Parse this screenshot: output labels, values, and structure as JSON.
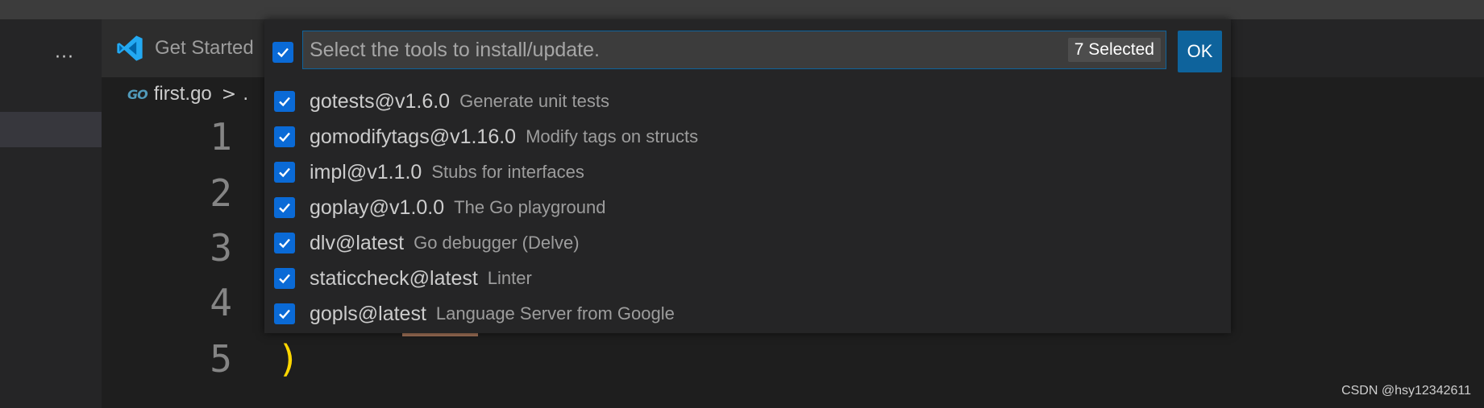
{
  "tab": {
    "label": "Get Started",
    "icon": "vscode-icon"
  },
  "breadcrumb": {
    "file": "first.go",
    "file_icon": "GO",
    "separator": ">",
    "more": "."
  },
  "editor": {
    "line_numbers": [
      "1",
      "2",
      "3",
      "4",
      "5"
    ],
    "closing_paren": ")"
  },
  "quickpick": {
    "placeholder": "Select the tools to install/update.",
    "selected_count": "7 Selected",
    "ok_label": "OK",
    "items": [
      {
        "name": "gotests@v1.6.0",
        "description": "Generate unit tests",
        "checked": true
      },
      {
        "name": "gomodifytags@v1.16.0",
        "description": "Modify tags on structs",
        "checked": true
      },
      {
        "name": "impl@v1.1.0",
        "description": "Stubs for interfaces",
        "checked": true
      },
      {
        "name": "goplay@v1.0.0",
        "description": "The Go playground",
        "checked": true
      },
      {
        "name": "dlv@latest",
        "description": "Go debugger (Delve)",
        "checked": true
      },
      {
        "name": "staticcheck@latest",
        "description": "Linter",
        "checked": true
      },
      {
        "name": "gopls@latest",
        "description": "Language Server from Google",
        "checked": true
      }
    ]
  },
  "sidebar": {
    "more_label": "···"
  },
  "watermark": "CSDN @hsy12342611",
  "colors": {
    "accent": "#0e639c",
    "checkbox": "#0a6ad6",
    "paren": "#ffd700",
    "go_icon": "#519aba"
  }
}
